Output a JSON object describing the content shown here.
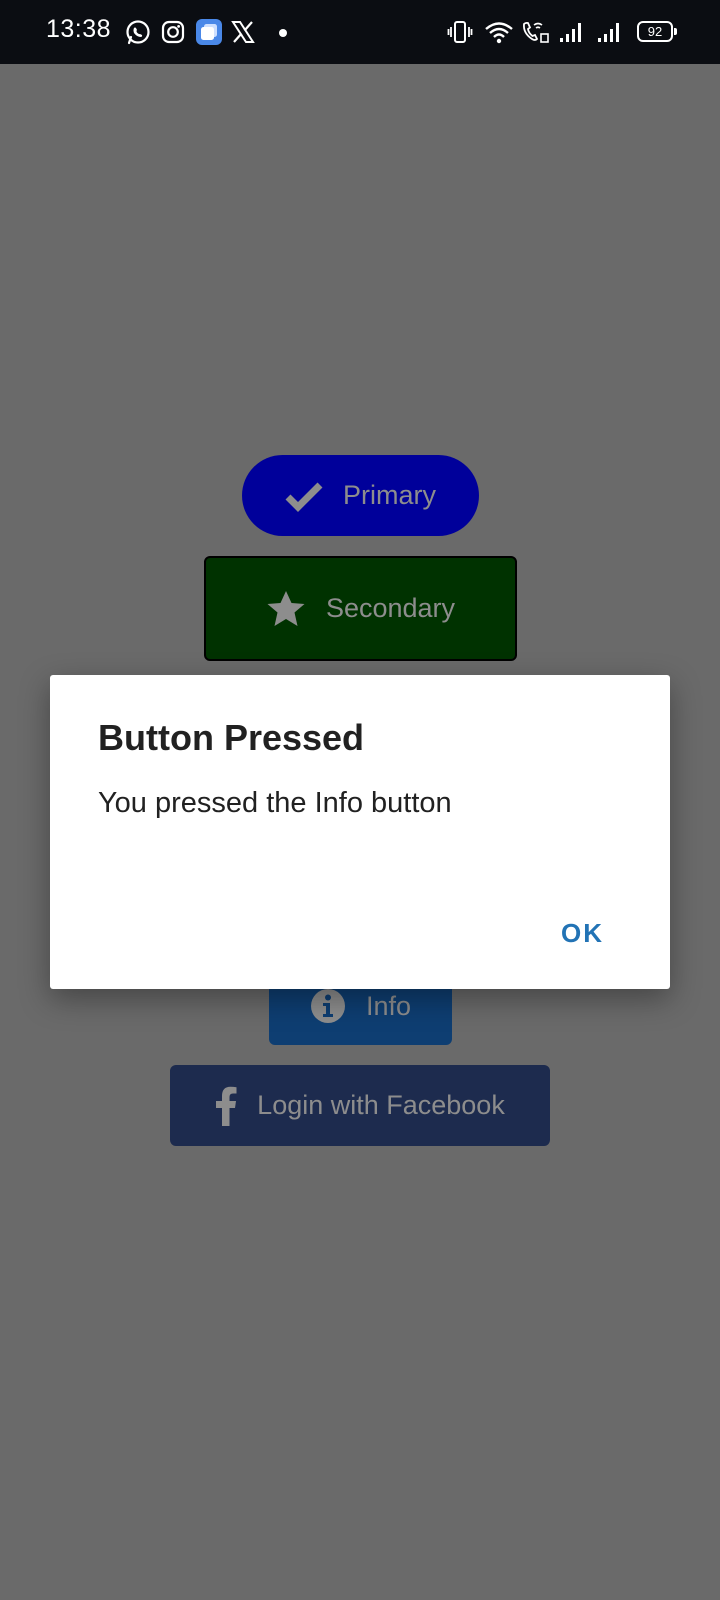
{
  "status_bar": {
    "time": "13:38",
    "battery": "92",
    "notification_icons": [
      "whatsapp-icon",
      "instagram-icon",
      "app-icon",
      "x-icon",
      "more-dot"
    ],
    "system_icons": [
      "vibrate-icon",
      "wifi-icon",
      "wifi-calling-icon",
      "signal-icon",
      "signal-icon"
    ]
  },
  "buttons": {
    "primary": {
      "label": "Primary",
      "icon": "check-icon",
      "color": "#00009a"
    },
    "secondary": {
      "label": "Secondary",
      "icon": "star-icon",
      "color": "#003200"
    },
    "info": {
      "label": "Info",
      "icon": "info-circle-icon",
      "color": "#0e3e72"
    },
    "facebook": {
      "label": "Login with Facebook",
      "icon": "facebook-icon",
      "color": "#1d2b4e"
    }
  },
  "dialog": {
    "title": "Button Pressed",
    "message": "You pressed the Info button",
    "ok_label": "OK",
    "accent_color": "#2273b5"
  }
}
